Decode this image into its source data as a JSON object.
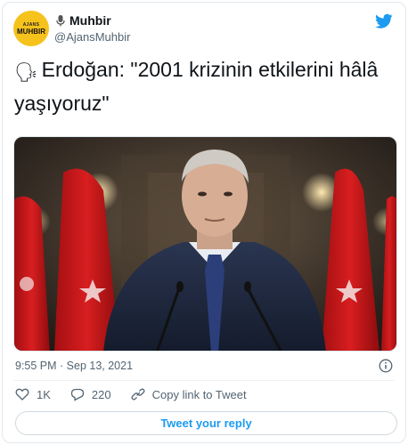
{
  "account": {
    "avatar_small": "AJANS",
    "avatar_big": "MUHBIR",
    "display_name": "Muhbir",
    "handle": "@AjansMuhbir"
  },
  "tweet": {
    "text": "Erdoğan: \"2001 krizinin etkilerini hâlâ yaşıyoruz\"",
    "timestamp": "9:55 PM · Sep 13, 2021"
  },
  "actions": {
    "like_count": "1K",
    "reply_count": "220",
    "copy_link_label": "Copy link to Tweet",
    "reply_button_label": "Tweet your reply"
  },
  "icons": [
    "mic-icon",
    "twitter-bird-icon",
    "speaking-head-icon",
    "info-icon",
    "heart-icon",
    "reply-icon",
    "link-icon"
  ],
  "colors": {
    "brand": "#1d9bf0",
    "secondary_text": "#536471",
    "avatar_bg": "#f6c21c"
  }
}
